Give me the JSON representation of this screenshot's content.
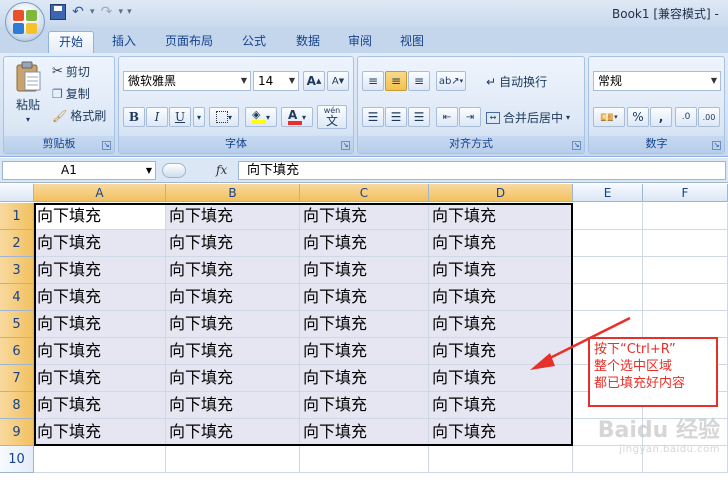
{
  "window": {
    "title": "Book1  [兼容模式] -"
  },
  "qat": {
    "save": "save-icon",
    "undo": "↶",
    "redo": "↷",
    "customize": "▾"
  },
  "tabs": [
    {
      "label": "开始",
      "active": true
    },
    {
      "label": "插入"
    },
    {
      "label": "页面布局"
    },
    {
      "label": "公式"
    },
    {
      "label": "数据"
    },
    {
      "label": "审阅"
    },
    {
      "label": "视图"
    }
  ],
  "ribbon": {
    "clipboard": {
      "label": "剪贴板",
      "paste": "粘贴",
      "cut": "剪切",
      "copy": "复制",
      "format_painter": "格式刷"
    },
    "font": {
      "label": "字体",
      "font_name": "微软雅黑",
      "font_size": "14",
      "grow": "A",
      "shrink": "A",
      "bold": "B",
      "italic": "I",
      "underline": "U",
      "phonetic": "wén"
    },
    "alignment": {
      "label": "对齐方式",
      "wrap_text": "自动换行",
      "merge_center": "合并后居中"
    },
    "number": {
      "label": "数字",
      "format": "常规",
      "percent": "%",
      "comma": ",",
      "inc_decimal": ".0",
      "dec_decimal": ".00"
    }
  },
  "formula_bar": {
    "name_box": "A1",
    "fx": "fx",
    "value": "向下填充"
  },
  "sheet": {
    "columns": [
      "A",
      "B",
      "C",
      "D",
      "E",
      "F"
    ],
    "rows": [
      "1",
      "2",
      "3",
      "4",
      "5",
      "6",
      "7",
      "8",
      "9",
      "10"
    ],
    "cells": [
      [
        "向下填充",
        "向下填充",
        "向下填充",
        "向下填充"
      ],
      [
        "向下填充",
        "向下填充",
        "向下填充",
        "向下填充"
      ],
      [
        "向下填充",
        "向下填充",
        "向下填充",
        "向下填充"
      ],
      [
        "向下填充",
        "向下填充",
        "向下填充",
        "向下填充"
      ],
      [
        "向下填充",
        "向下填充",
        "向下填充",
        "向下填充"
      ],
      [
        "向下填充",
        "向下填充",
        "向下填充",
        "向下填充"
      ],
      [
        "向下填充",
        "向下填充",
        "向下填充",
        "向下填充"
      ],
      [
        "向下填充",
        "向下填充",
        "向下填充",
        "向下填充"
      ],
      [
        "向下填充",
        "向下填充",
        "向下填充",
        "向下填充"
      ]
    ]
  },
  "annotation": {
    "line1": "按下“Ctrl+R”",
    "line2": "整个选中区域",
    "line3": "都已填充好内容",
    "color": "#e8302a"
  },
  "watermark": {
    "text": "Baidu 经验",
    "sub": "jingyan.baidu.com"
  }
}
